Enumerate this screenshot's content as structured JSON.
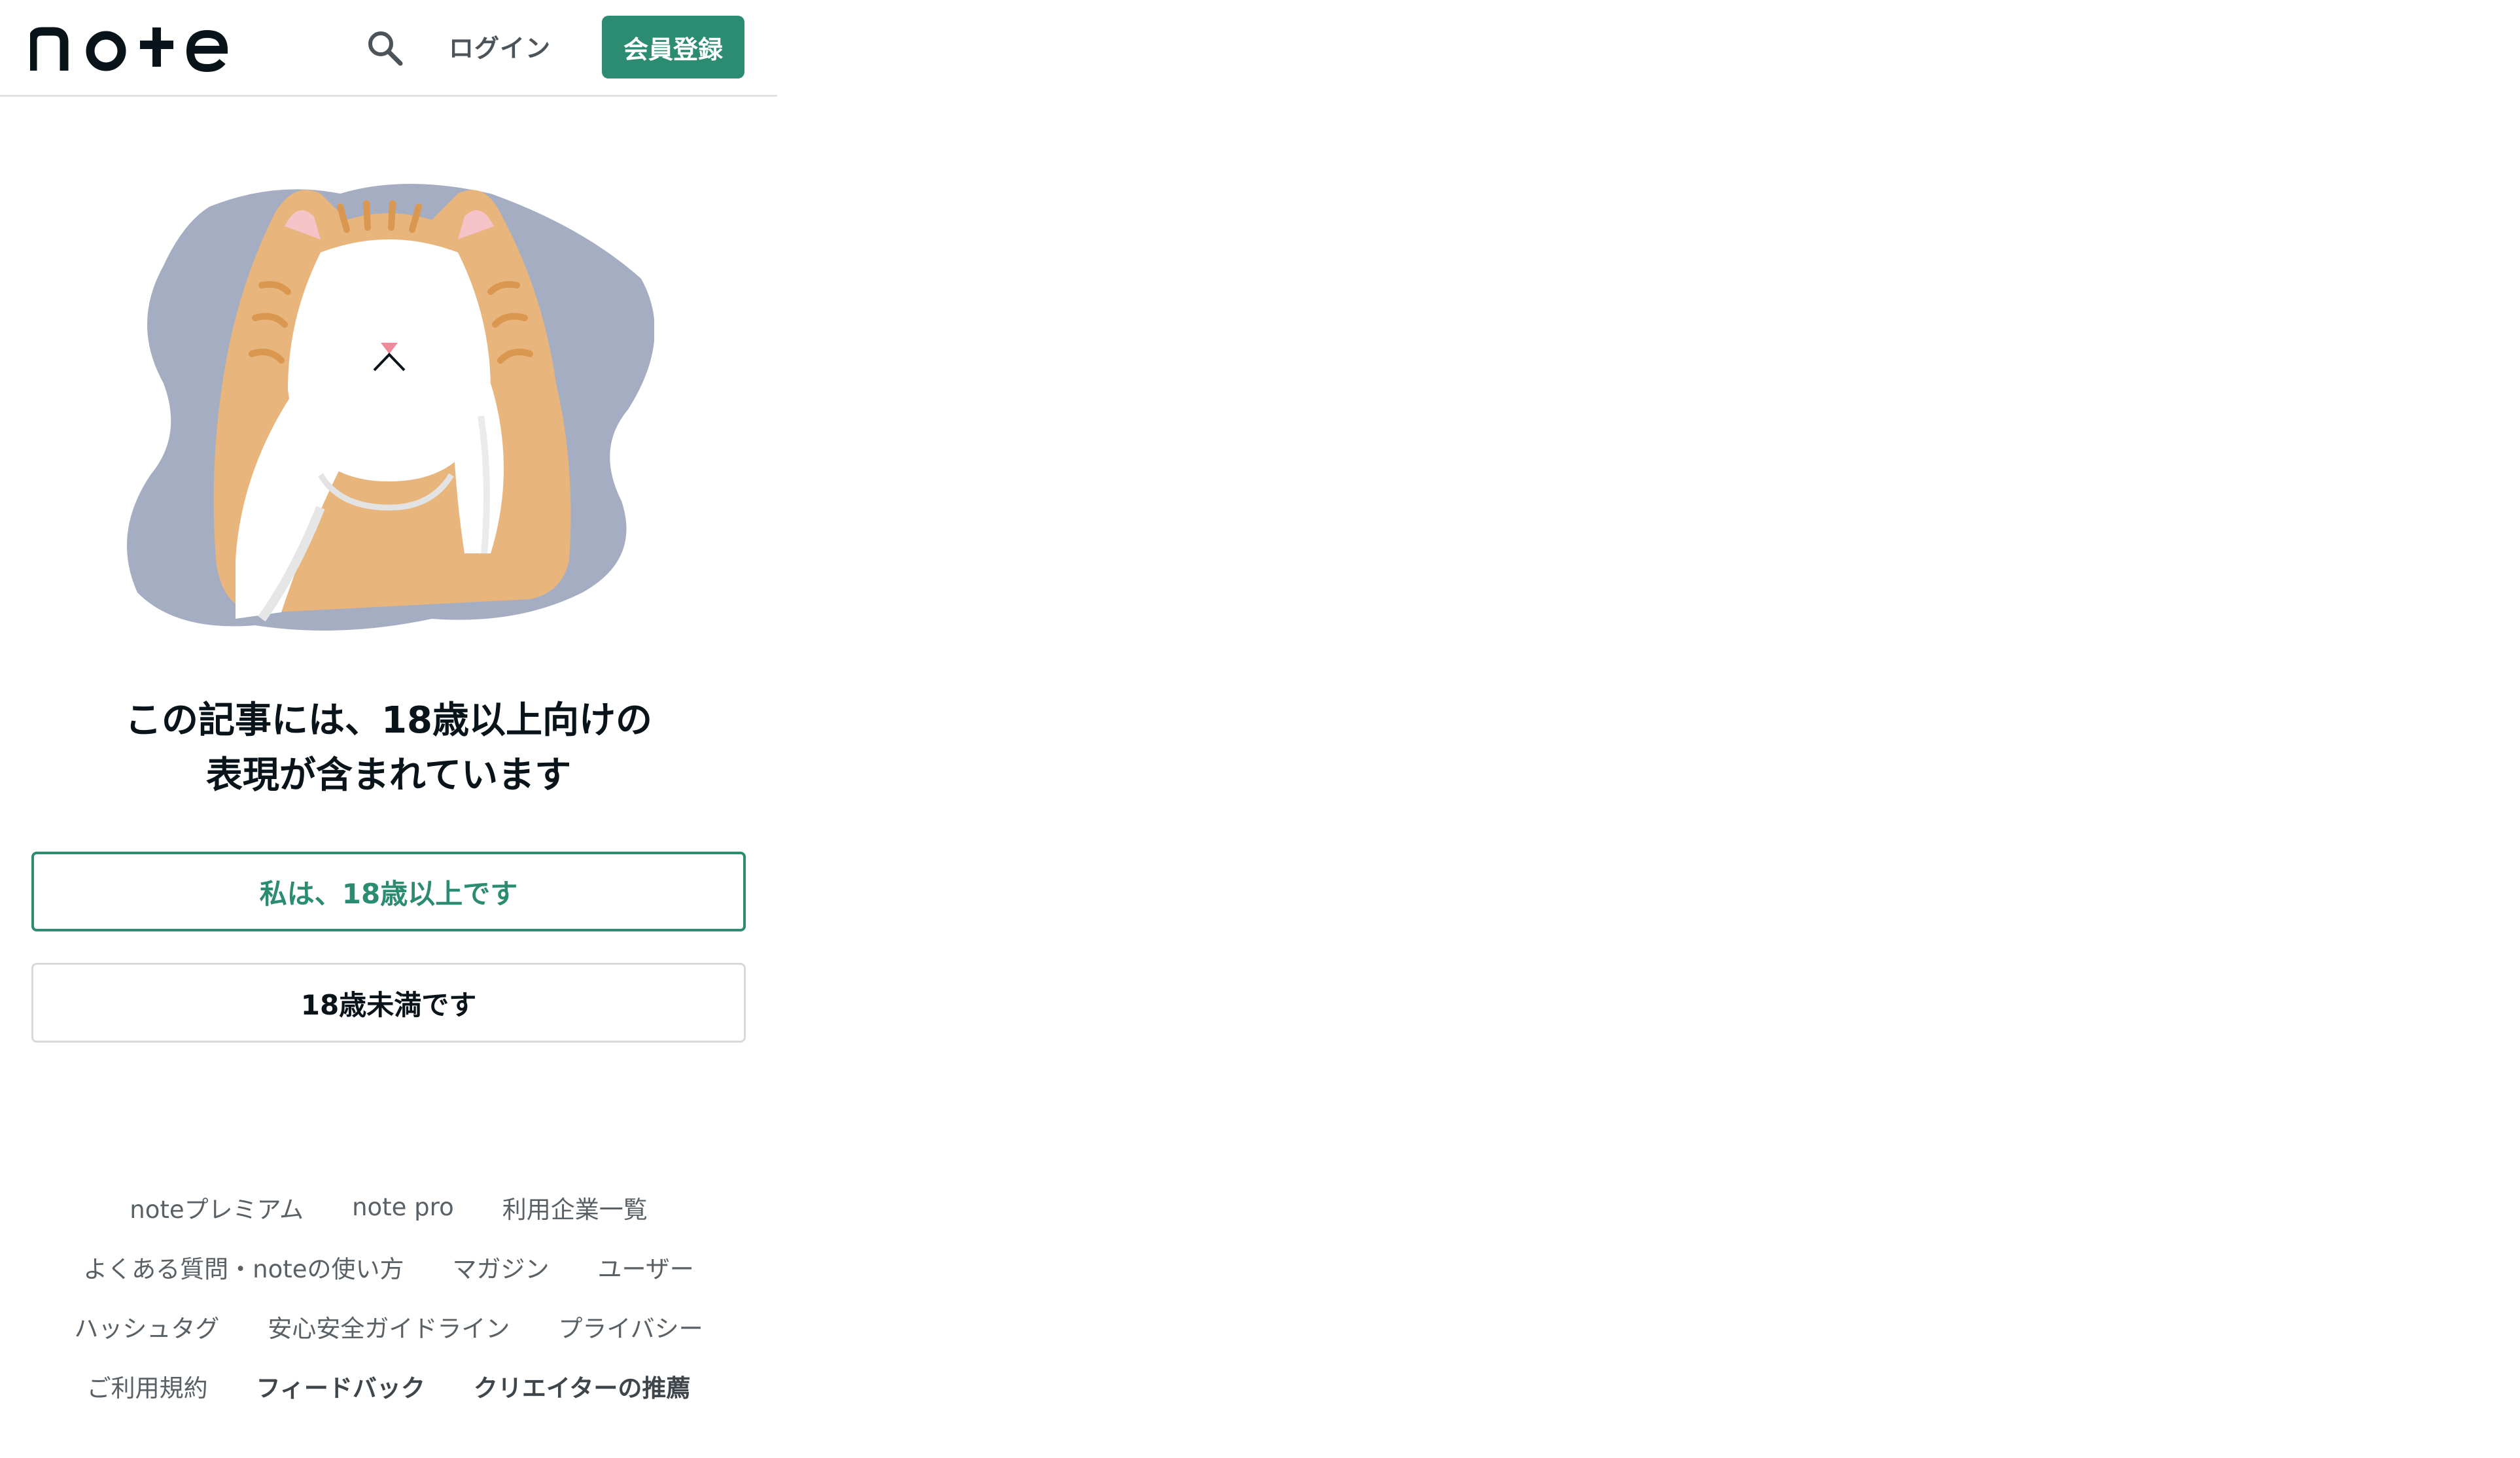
{
  "header": {
    "logo_text": "note",
    "login_label": "ログイン",
    "signup_label": "会員登録",
    "brand_color": "#2b8c71"
  },
  "main": {
    "message_line1": "この記事には、18歳以上向けの",
    "message_line2": "表現が含まれています",
    "adult_button_label": "私は、18歳以上です",
    "minor_button_label": "18歳未満です"
  },
  "footer": {
    "rows": [
      [
        {
          "label": "noteプレミアム",
          "bold": false
        },
        {
          "label": "note pro",
          "bold": false
        },
        {
          "label": "利用企業一覧",
          "bold": false
        }
      ],
      [
        {
          "label": "よくある質問・noteの使い方",
          "bold": false
        },
        {
          "label": "マガジン",
          "bold": false
        },
        {
          "label": "ユーザー",
          "bold": false
        }
      ],
      [
        {
          "label": "ハッシュタグ",
          "bold": false
        },
        {
          "label": "安心安全ガイドライン",
          "bold": false
        },
        {
          "label": "プライバシー",
          "bold": false
        }
      ],
      [
        {
          "label": "ご利用規約",
          "bold": false
        },
        {
          "label": "フィードバック",
          "bold": true
        },
        {
          "label": "クリエイターの推薦",
          "bold": true
        }
      ]
    ]
  }
}
